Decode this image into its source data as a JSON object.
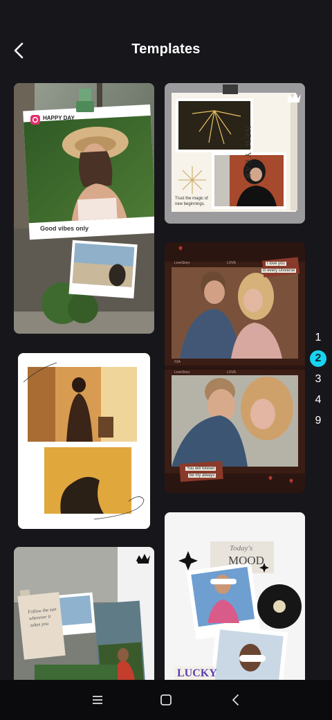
{
  "header": {
    "title": "Templates"
  },
  "cards": {
    "happy_day": {
      "badge": "HAPPY DAY",
      "caption": "Good vibes only"
    },
    "new_year": {
      "title": "NEW YEAR",
      "tagline_1": "Trust the magic of",
      "tagline_2": "new beginnings."
    },
    "love_film": {
      "strip_1_left": "LoveStory",
      "strip_1_mid": "LOVE",
      "note_1a": "I love you",
      "note_1b": "in every Universe",
      "frame_1": "01A",
      "strip_2_left": "LoveStory",
      "strip_2_mid": "LOVE",
      "note_2a": "You will forever",
      "note_2b": "be my always"
    },
    "todays_mood": {
      "title_1": "Today's",
      "title_2": "MOOD",
      "lucky": "LUCKY"
    },
    "travel_note": {
      "note_1": "Follow the sun",
      "note_2": "wherever it",
      "note_3": "takes you"
    }
  },
  "pager": {
    "pages": [
      "1",
      "2",
      "3",
      "4",
      "9"
    ],
    "active": "2"
  },
  "colors": {
    "accent": "#19d4f0",
    "background": "#17161a"
  },
  "icons": [
    "back-arrow-icon",
    "crown-icon",
    "instagram-icon",
    "clip-icon",
    "menu-icon",
    "home-icon",
    "back-icon"
  ]
}
